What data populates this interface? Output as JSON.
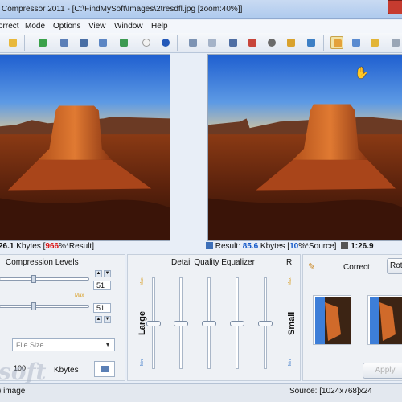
{
  "window": {
    "title": "Compressor 2011 - [C:\\FindMySoft\\Images\\2tresdfl.jpg  [zoom:40%]]"
  },
  "menu": [
    "orrect",
    "Mode",
    "Options",
    "View",
    "Window",
    "Help"
  ],
  "toolbar_icons": [
    "open-icon",
    "save-icon",
    "settings-icon",
    "batch-icon",
    "compress-icon",
    "export-icon",
    "tips-icon",
    "info-icon",
    "split-view-icon",
    "single-view-icon",
    "crop-icon",
    "color-icon",
    "preview-icon",
    "edit-icon",
    "rotate-icon",
    "hand-icon",
    "zoom-icon",
    "magic-icon",
    "grid-icon"
  ],
  "status_left": {
    "size_value": "26.1",
    "size_unit": " Kbytes",
    "bracket_open": " [",
    "percent": "966",
    "percent_suffix": "%*Result]"
  },
  "status_right": {
    "result_label": " Result: ",
    "result_value": "85.6",
    "result_unit": " Kbytes",
    "bracket_open": " [",
    "percent": "10",
    "percent_suffix": "%*Source]",
    "ratio": " 1:26.9"
  },
  "compression": {
    "title": "Compression Levels",
    "value1": "51",
    "value2": "51",
    "max_label": "Max",
    "mode_select": "File Size",
    "target_value": "100",
    "target_unit": "Kbytes"
  },
  "equalizer": {
    "title": "Detail Quality Equalizer",
    "r_label": "R",
    "large_label": "Large",
    "small_label": "Small",
    "max_label": "Max",
    "min_label": "Min",
    "thumb_levels": [
      0.5,
      0.5,
      0.5,
      0.5,
      0.5
    ]
  },
  "correct_panel": {
    "title": "Correct",
    "rotate_button": "Rota",
    "apply_button": "Apply"
  },
  "statusbar": {
    "left": ") image",
    "right": "Source: [1024x768]x24"
  },
  "watermark": "soft",
  "colors": {
    "accent": "#1459c9",
    "warning": "#d11111",
    "title_bar": "#aecaee",
    "sky": "#2e6ad3"
  }
}
